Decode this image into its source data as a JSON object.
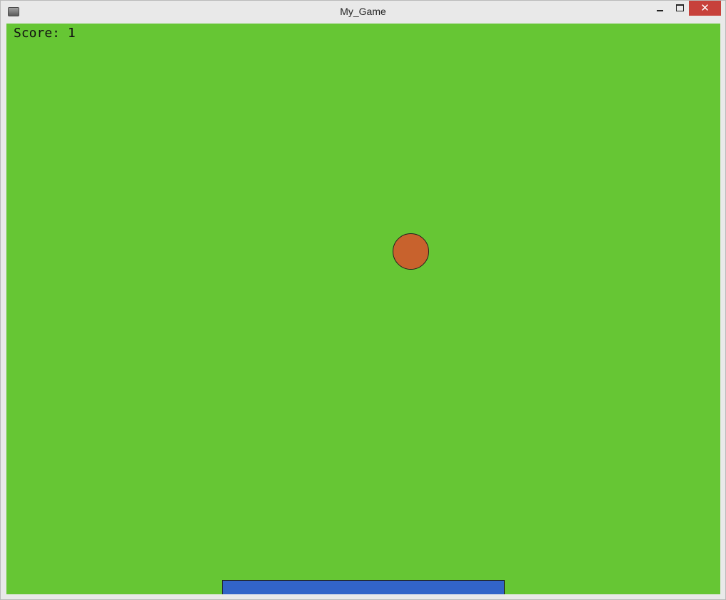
{
  "window": {
    "title": "My_Game",
    "controls": {
      "minimize": "minimize-icon",
      "maximize": "maximize-icon",
      "close": "close-icon",
      "close_glyph": "✕"
    }
  },
  "game": {
    "score_text": "Score: 1",
    "background_color": "#66c634",
    "ball_color": "#c8622d",
    "paddle_color": "#3264c8"
  }
}
